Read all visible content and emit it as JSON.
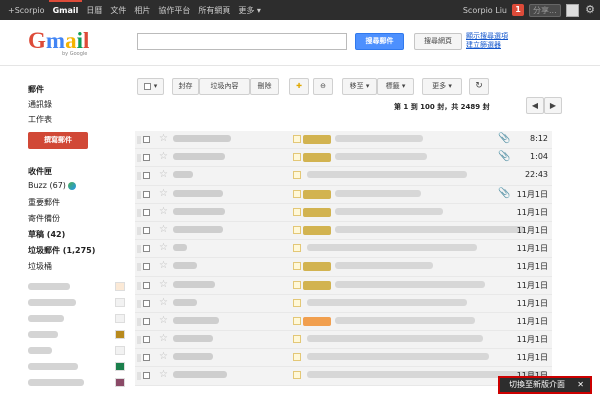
{
  "topnav": {
    "items": [
      "+Scorpio",
      "Gmail",
      "日曆",
      "文件",
      "相片",
      "協作平台",
      "所有網頁",
      "更多 ▾"
    ],
    "active_index": 1,
    "user": "Scorpio Liu",
    "notifications": "1",
    "share_placeholder": "分享..."
  },
  "header": {
    "logo_text": "Gmail",
    "logo_sub": "by Google",
    "search_button": "搜尋郵件",
    "web_search_button": "搜尋網頁",
    "show_options": "顯示搜尋選項",
    "create_filter": "建立篩選器"
  },
  "sidebar": {
    "top_links": [
      "郵件",
      "通訊錄",
      "工作表"
    ],
    "compose": "撰寫郵件",
    "folders": [
      {
        "label": "收件匣",
        "bold": true
      },
      {
        "label": "Buzz (67)",
        "bold": false
      },
      {
        "label": "重要郵件",
        "bold": false
      },
      {
        "label": "寄件備份",
        "bold": false
      },
      {
        "label": "草稿 (42)",
        "bold": true
      },
      {
        "label": "垃圾郵件 (1,275)",
        "bold": true
      },
      {
        "label": "垃圾桶",
        "bold": false
      }
    ],
    "label_colors": [
      "#fbe9d6",
      "#f2f2f2",
      "#f2f2f2",
      "#b88a1e",
      "#f2f2f2",
      "#1a7f4c",
      "#8a4a67"
    ]
  },
  "toolbar": {
    "archive": "封存",
    "spam": "垃圾內容",
    "delete": "刪除",
    "move_to": "移至 ▾",
    "labels": "標籤 ▾",
    "more": "更多 ▾",
    "refresh": "↻"
  },
  "pager": {
    "text": "第 1 到 100 封，共 2489 封",
    "prev": "◀",
    "next": "▶"
  },
  "mails": [
    {
      "date": "8:12",
      "tag": "yellow",
      "clip": true
    },
    {
      "date": "1:04",
      "tag": "yellow",
      "clip": true
    },
    {
      "date": "22:43",
      "tag": "none",
      "clip": false
    },
    {
      "date": "11月1日",
      "tag": "yellow",
      "clip": true
    },
    {
      "date": "11月1日",
      "tag": "yellow",
      "clip": false
    },
    {
      "date": "11月1日",
      "tag": "yellow",
      "clip": false
    },
    {
      "date": "11月1日",
      "tag": "none",
      "clip": false
    },
    {
      "date": "11月1日",
      "tag": "yellow",
      "clip": false
    },
    {
      "date": "11月1日",
      "tag": "yellow",
      "clip": false
    },
    {
      "date": "11月1日",
      "tag": "none",
      "clip": false
    },
    {
      "date": "11月1日",
      "tag": "orange",
      "clip": false
    },
    {
      "date": "11月1日",
      "tag": "none",
      "clip": false
    },
    {
      "date": "11月1日",
      "tag": "none",
      "clip": false
    },
    {
      "date": "11月1日",
      "tag": "none",
      "clip": false
    }
  ],
  "switch_button": {
    "label": "切換至新版介面",
    "close": "✕"
  }
}
